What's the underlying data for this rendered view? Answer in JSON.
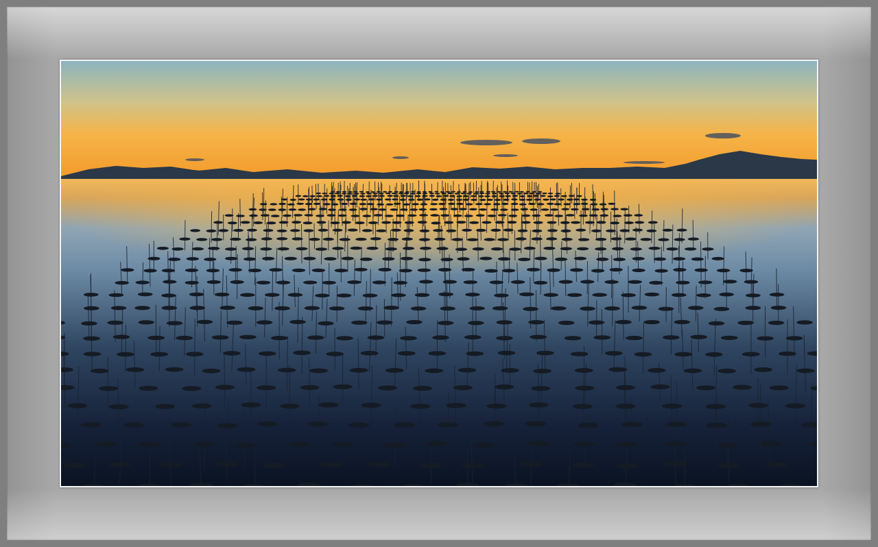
{
  "scene": {
    "subject": "seaweed-farm-poles-at-sunset",
    "colors": {
      "sky_top": "#8fb3bd",
      "sky_mid": "#f2c45a",
      "sky_horizon": "#f29a2c",
      "mountains": "#2c3a4a",
      "water_far": "#e8a040",
      "water_mid": "#5a7590",
      "water_near": "#0d1624",
      "patches": "#141a22",
      "mat": "#a8a8a8",
      "frame_outer": "#7f7f7f"
    }
  }
}
